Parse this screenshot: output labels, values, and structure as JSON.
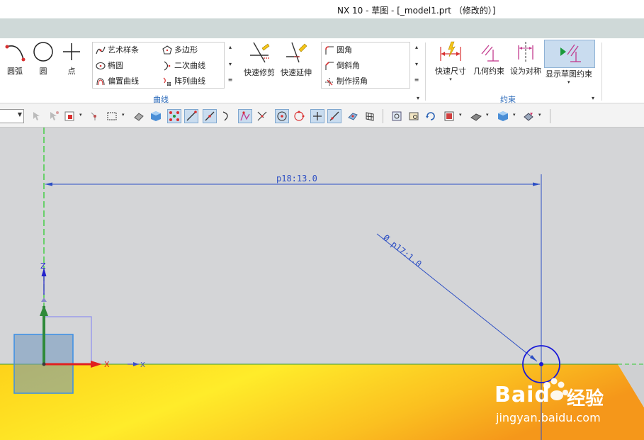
{
  "window": {
    "title": "NX 10 - 草图 - [_model1.prt （修改的）]"
  },
  "ribbon": {
    "left_tools": [
      {
        "label": "圆弧",
        "icon": "arc-icon"
      },
      {
        "label": "圆",
        "icon": "circle-icon"
      },
      {
        "label": "点",
        "icon": "point-icon"
      }
    ],
    "curve_gallery": [
      {
        "label": "艺术样条",
        "icon": "studio-spline-icon"
      },
      {
        "label": "多边形",
        "icon": "polygon-icon"
      },
      {
        "label": "椭圆",
        "icon": "ellipse-icon"
      },
      {
        "label": "二次曲线",
        "icon": "conic-icon"
      },
      {
        "label": "偏置曲线",
        "icon": "offset-curve-icon"
      },
      {
        "label": "阵列曲线",
        "icon": "pattern-curve-icon"
      }
    ],
    "edit_tools": [
      {
        "label": "快速修剪",
        "icon": "quick-trim-icon"
      },
      {
        "label": "快速延伸",
        "icon": "quick-extend-icon"
      }
    ],
    "corner_gallery": [
      {
        "label": "圆角",
        "icon": "fillet-icon"
      },
      {
        "label": "倒斜角",
        "icon": "chamfer-icon"
      },
      {
        "label": "制作拐角",
        "icon": "make-corner-icon"
      }
    ],
    "curve_group_label": "曲线",
    "constraint_tools": [
      {
        "label": "快速尺寸",
        "icon": "rapid-dimension-icon"
      },
      {
        "label": "几何约束",
        "icon": "geometric-constraint-icon"
      },
      {
        "label": "设为对称",
        "icon": "make-symmetric-icon"
      },
      {
        "label": "显示草图约束",
        "icon": "show-sketch-constraints-icon"
      }
    ],
    "constraint_group_label": "约束"
  },
  "canvas": {
    "dimension_horizontal": "p18:13.0",
    "dimension_diameter": "Ø p17:1.0",
    "axis_z": "Z",
    "axis_x": "X",
    "axis_x_secondary": "X",
    "watermark_brand": "Baid",
    "watermark_suffix": "经验",
    "watermark_url": "jingyan.baidu.com",
    "colors": {
      "viewport_background": "#d4d5d7",
      "ground_gradient_start": "#ffe000",
      "ground_gradient_end": "#f7a21a",
      "dimension_line": "#2d4fc4",
      "circle": "#1a1ad8",
      "y_axis_dash": "#22cc22",
      "x_axis": "#e02020",
      "z_axis": "#2222cc"
    }
  }
}
